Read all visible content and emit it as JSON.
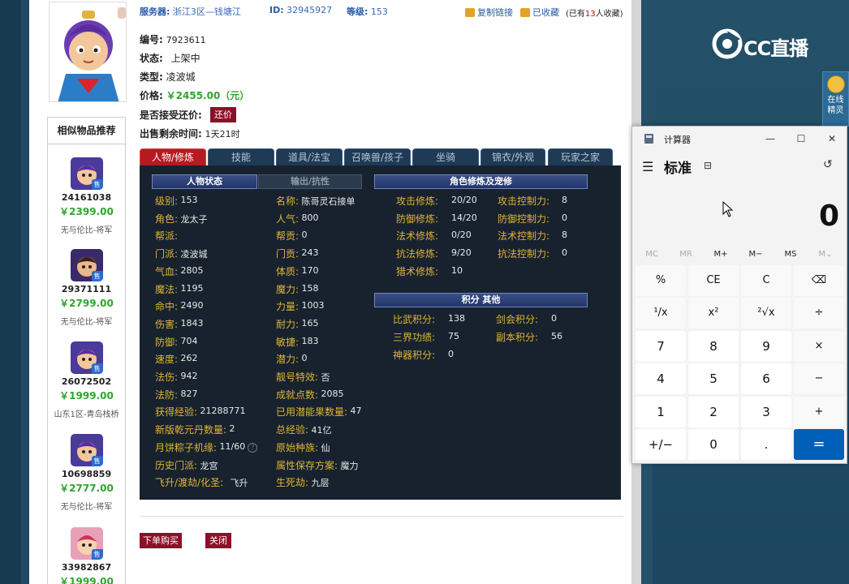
{
  "window": {
    "width": 1046,
    "height": 720
  },
  "listing": {
    "server_label": "服务器:",
    "server_value": "浙江3区—钱塘江",
    "id_label": "ID:",
    "id_value": "32945927",
    "level_label": "等级:",
    "level_value": "153",
    "copy_link": "复制链接",
    "favorited": "已收藏",
    "fav_prefix": "(已有",
    "fav_count": "13",
    "fav_suffix": "人收藏)",
    "number_label": "编号:",
    "number_value": "7923611",
    "status_label": "状态:",
    "status_value": "上架中",
    "type_label": "类型:",
    "type_value": "凌波城",
    "price_label": "价格:",
    "price_value": "￥2455.00（元）",
    "haggle_label": "是否接受还价:",
    "haggle_button": "还价",
    "remain_label": "出售剩余时间:",
    "remain_value": "1天21时"
  },
  "similar": {
    "title": "相似物品推荐",
    "items": [
      {
        "id": "24161038",
        "price": "￥2399.00",
        "server": "无与伦比-将军",
        "tag": "售"
      },
      {
        "id": "29371111",
        "price": "￥2799.00",
        "server": "无与伦比-将军",
        "tag": "售"
      },
      {
        "id": "26072502",
        "price": "￥1999.00",
        "server": "山东1区-青岛栈桥",
        "tag": "售"
      },
      {
        "id": "10698859",
        "price": "￥2777.00",
        "server": "无与伦比-将军",
        "tag": "售"
      },
      {
        "id": "33982867",
        "price": "￥1999.00",
        "server": "",
        "tag": "售"
      }
    ]
  },
  "tabs": [
    "人物/修炼",
    "技能",
    "道具/法宝",
    "召唤兽/孩子",
    "坐骑",
    "锦衣/外观",
    "玩家之家"
  ],
  "panel": {
    "sec_status": "人物状态",
    "sec_output": "输出/抗性",
    "sec_cultivation": "角色修炼及宠修",
    "sec_points": "积分 其他",
    "col1": [
      {
        "label": "级别:",
        "value": "153"
      },
      {
        "label": "角色:",
        "value": "龙太子"
      },
      {
        "label": "帮派:",
        "value": ""
      },
      {
        "label": "门派:",
        "value": "凌波城"
      },
      {
        "label": "气血:",
        "value": "2805"
      },
      {
        "label": "魔法:",
        "value": "1195"
      },
      {
        "label": "命中:",
        "value": "2490"
      },
      {
        "label": "伤害:",
        "value": "1843"
      },
      {
        "label": "防御:",
        "value": "704"
      },
      {
        "label": "速度:",
        "value": "262"
      },
      {
        "label": "法伤:",
        "value": "942"
      },
      {
        "label": "法防:",
        "value": "827"
      },
      {
        "label": "获得经验:",
        "value": "21288771"
      },
      {
        "label": "新版乾元丹数量:",
        "value": "2"
      },
      {
        "label": "月饼粽子机缘:",
        "value": "11/60"
      },
      {
        "label": "历史门派:",
        "value": "龙宫"
      },
      {
        "label": "飞升/渡劫/化圣:",
        "value": "飞升"
      }
    ],
    "col2": [
      {
        "label": "名称:",
        "value": "陈哥灵石接单"
      },
      {
        "label": "人气:",
        "value": "800"
      },
      {
        "label": "帮贡:",
        "value": "0"
      },
      {
        "label": "门贡:",
        "value": "243"
      },
      {
        "label": "体质:",
        "value": "170"
      },
      {
        "label": "魔力:",
        "value": "158"
      },
      {
        "label": "力量:",
        "value": "1003"
      },
      {
        "label": "耐力:",
        "value": "165"
      },
      {
        "label": "敏捷:",
        "value": "183"
      },
      {
        "label": "潜力:",
        "value": "0"
      },
      {
        "label": "靓号特效:",
        "value": "否"
      },
      {
        "label": "成就点数:",
        "value": "2085"
      },
      {
        "label": "已用潜能果数量:",
        "value": "47"
      },
      {
        "label": "总经验:",
        "value": "41亿"
      },
      {
        "label": "原始种族:",
        "value": "仙"
      },
      {
        "label": "属性保存方案:",
        "value": "魔力"
      },
      {
        "label": "生死劫:",
        "value": "九层"
      }
    ],
    "cult_left": [
      {
        "label": "攻击修炼:",
        "value": "20/20"
      },
      {
        "label": "防御修炼:",
        "value": "14/20"
      },
      {
        "label": "法术修炼:",
        "value": "0/20"
      },
      {
        "label": "抗法修炼:",
        "value": "9/20"
      },
      {
        "label": "猎术修炼:",
        "value": "10"
      }
    ],
    "cult_right": [
      {
        "label": "攻击控制力:",
        "value": "8"
      },
      {
        "label": "防御控制力:",
        "value": "0"
      },
      {
        "label": "法术控制力:",
        "value": "8"
      },
      {
        "label": "抗法控制力:",
        "value": "0"
      }
    ],
    "points_left": [
      {
        "label": "比武积分:",
        "value": "138"
      },
      {
        "label": "三界功绩:",
        "value": "75"
      },
      {
        "label": "神器积分:",
        "value": "0"
      }
    ],
    "points_right": [
      {
        "label": "剑会积分:",
        "value": "0"
      },
      {
        "label": "副本积分:",
        "value": "56"
      }
    ]
  },
  "actions": {
    "buy": "下单购买",
    "close": "关闭"
  },
  "overlay": {
    "brand": "CC直播",
    "spirit_line1": "在线",
    "spirit_line2": "精灵"
  },
  "calculator": {
    "title": "计算器",
    "mode": "标准",
    "display": "0",
    "minimize": "—",
    "maximize": "☐",
    "close": "✕",
    "menu_glyph": "☰",
    "keep_glyph": "⊟",
    "history_glyph": "↺",
    "memory": [
      "MC",
      "MR",
      "M+",
      "M−",
      "MS",
      "M⌄"
    ],
    "keys": [
      [
        "%",
        "CE",
        "C",
        "⌫"
      ],
      [
        "¹/x",
        "x²",
        "²√x",
        "÷"
      ],
      [
        "7",
        "8",
        "9",
        "×"
      ],
      [
        "4",
        "5",
        "6",
        "−"
      ],
      [
        "1",
        "2",
        "3",
        "+"
      ],
      [
        "+/−",
        "0",
        ".",
        "="
      ]
    ]
  },
  "colors": {
    "accent_red": "#8c1028",
    "price_green": "#2fa42f",
    "stat_label": "#e0b437",
    "calc_equals": "#005fb8"
  }
}
